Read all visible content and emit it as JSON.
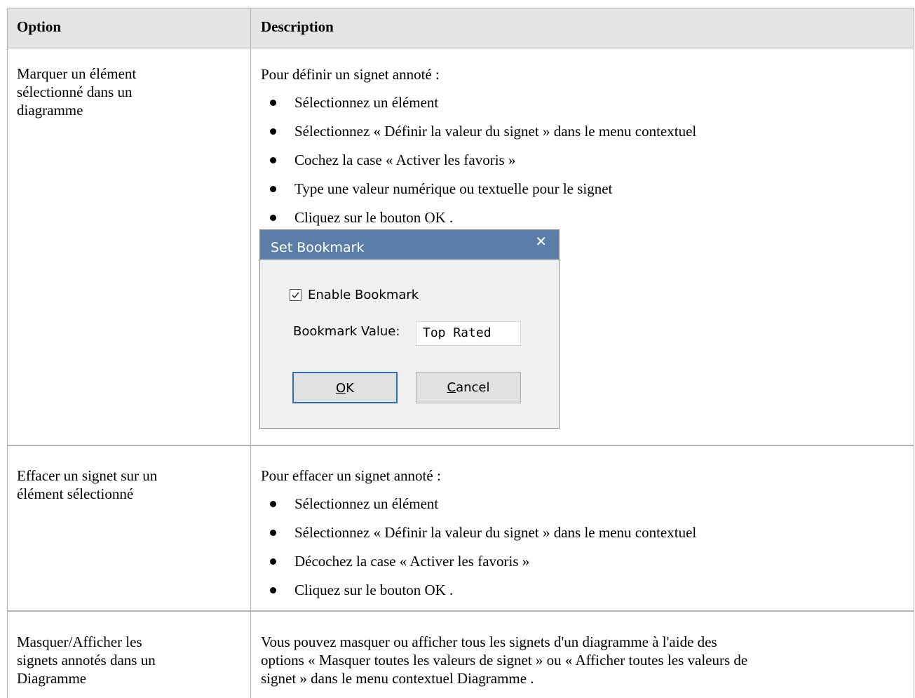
{
  "table": {
    "headers": [
      "Option",
      "Description"
    ],
    "rows": [
      {
        "option": [
          "Marquer un élément",
          "sélectionné dans un",
          "diagramme"
        ],
        "intro": "Pour définir un signet annoté :",
        "bullets": [
          "Sélectionnez un élément",
          "Sélectionnez « Définir la valeur du signet » dans le menu contextuel",
          "Cochez la case « Activer les favoris »",
          "Type une valeur numérique ou textuelle pour le signet",
          "Cliquez sur le bouton OK ."
        ]
      },
      {
        "option": [
          "Effacer un signet sur un",
          "élément sélectionné"
        ],
        "intro": "Pour effacer un signet annoté :",
        "bullets": [
          "Sélectionnez un élément",
          "Sélectionnez « Définir la valeur du signet » dans le menu contextuel",
          "Décochez la case « Activer les favoris »",
          "Cliquez sur le bouton OK ."
        ]
      },
      {
        "option": [
          "Masquer/Afficher les",
          "signets annotés dans un",
          "Diagramme"
        ],
        "lines": [
          "Vous pouvez masquer ou afficher tous les signets d'un diagramme à l'aide des",
          "options « Masquer toutes les valeurs de signet » ou « Afficher toutes les valeurs de",
          "signet » dans le menu contextuel Diagramme ."
        ]
      }
    ]
  },
  "dialog": {
    "title": "Set Bookmark",
    "close_icon": "✕",
    "enable_label": "Enable Bookmark",
    "enable_checked": true,
    "value_label": "Bookmark Value:",
    "value": "Top Rated",
    "ok_accel": "O",
    "ok_rest": "K",
    "cancel_accel": "C",
    "cancel_rest": "ancel"
  }
}
